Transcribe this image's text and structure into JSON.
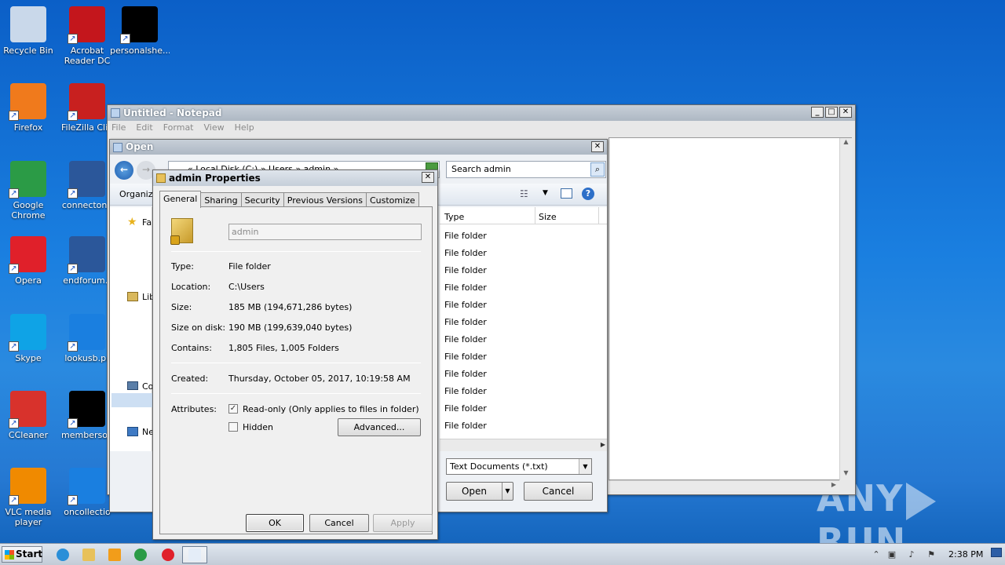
{
  "desktop": {
    "icons": [
      {
        "label": "Recycle Bin",
        "icon": "recycle-bin-icon",
        "color": "#c9d8ea"
      },
      {
        "label": "Acrobat Reader DC",
        "icon": "acrobat-icon",
        "color": "#c4161c"
      },
      {
        "label": "personalshe...",
        "icon": "file-icon",
        "color": "#000000"
      },
      {
        "label": "Firefox",
        "icon": "firefox-icon",
        "color": "#f07a1c"
      },
      {
        "label": "FileZilla Clie",
        "icon": "filezilla-icon",
        "color": "#c8201f"
      },
      {
        "label": "Google Chrome",
        "icon": "chrome-icon",
        "color": "#2b9b46"
      },
      {
        "label": "connectone",
        "icon": "word-doc-icon",
        "color": "#2b579a"
      },
      {
        "label": "Opera",
        "icon": "opera-icon",
        "color": "#e0202a"
      },
      {
        "label": "endforum.r",
        "icon": "word-doc-icon",
        "color": "#2b579a"
      },
      {
        "label": "Skype",
        "icon": "skype-icon",
        "color": "#0fa3e6"
      },
      {
        "label": "lookusb.pr",
        "icon": "file-icon",
        "color": "#1a7fe0"
      },
      {
        "label": "CCleaner",
        "icon": "ccleaner-icon",
        "color": "#d8322c"
      },
      {
        "label": "membersop",
        "icon": "file-icon",
        "color": "#000000"
      },
      {
        "label": "VLC media player",
        "icon": "vlc-icon",
        "color": "#f08a00"
      },
      {
        "label": "oncollectio",
        "icon": "file-icon",
        "color": "#1a7fe0"
      }
    ],
    "watermark_left": "ANY",
    "watermark_right": "RUN"
  },
  "notepad": {
    "title": "Untitled - Notepad",
    "menu": [
      "File",
      "Edit",
      "Format",
      "View",
      "Help"
    ]
  },
  "open_dialog": {
    "title": "Open",
    "address": "« Local Disk (C:) » Users » admin »",
    "search_placeholder": "Search admin",
    "organize": "Organize",
    "columns": {
      "type": "Type",
      "size": "Size"
    },
    "nav_partial": [
      "Fa",
      "Lib",
      "Co",
      "Ne"
    ],
    "files": [
      {
        "type": "File folder"
      },
      {
        "type": "File folder"
      },
      {
        "type": "File folder"
      },
      {
        "type": "File folder"
      },
      {
        "type": "File folder"
      },
      {
        "type": "File folder"
      },
      {
        "type": "File folder"
      },
      {
        "type": "File folder"
      },
      {
        "type": "File folder"
      },
      {
        "type": "File folder"
      },
      {
        "type": "File folder"
      },
      {
        "type": "File folder"
      }
    ],
    "filter": "Text Documents (*.txt)",
    "open_label": "Open",
    "cancel_label": "Cancel"
  },
  "properties": {
    "title": "admin Properties",
    "tabs": [
      "General",
      "Sharing",
      "Security",
      "Previous Versions",
      "Customize"
    ],
    "name_value": "admin",
    "rows": {
      "type_label": "Type:",
      "type_value": "File folder",
      "location_label": "Location:",
      "location_value": "C:\\Users",
      "size_label": "Size:",
      "size_value": "185 MB (194,671,286 bytes)",
      "disk_label": "Size on disk:",
      "disk_value": "190 MB (199,639,040 bytes)",
      "contains_label": "Contains:",
      "contains_value": "1,805 Files, 1,005 Folders",
      "created_label": "Created:",
      "created_value": "Thursday, October 05, 2017, 10:19:58 AM",
      "attributes_label": "Attributes:"
    },
    "readonly_label": "Read-only (Only applies to files in folder)",
    "readonly_checked": true,
    "hidden_label": "Hidden",
    "hidden_checked": false,
    "advanced_label": "Advanced...",
    "ok_label": "OK",
    "cancel_label": "Cancel",
    "apply_label": "Apply"
  },
  "taskbar": {
    "start_label": "Start",
    "clock": "2:38 PM",
    "pinned": [
      {
        "icon": "ie-icon",
        "color": "#2a8fd8"
      },
      {
        "icon": "explorer-icon",
        "color": "#e8c15a"
      },
      {
        "icon": "media-player-icon",
        "color": "#f29d1a"
      },
      {
        "icon": "chrome-icon",
        "color": "#2b9b46"
      },
      {
        "icon": "opera-icon",
        "color": "#e0202a"
      },
      {
        "icon": "notepad-icon",
        "color": "#bcd3ee"
      }
    ]
  }
}
